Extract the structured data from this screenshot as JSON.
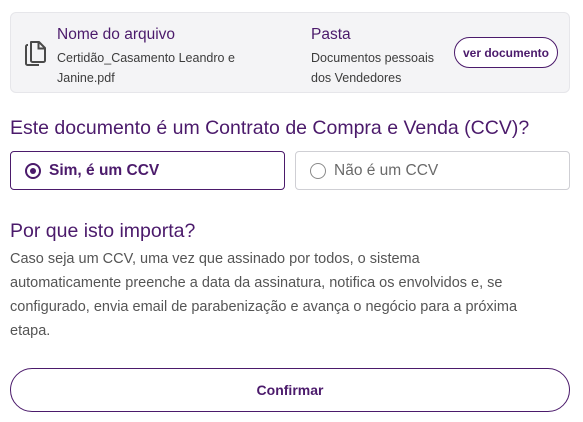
{
  "file_card": {
    "file_title": "Nome do arquivo",
    "file_name_line1": "Certidão_Casamento Leandro e",
    "file_name_line2": "Janine.pdf",
    "folder_title": "Pasta",
    "folder_name_line1": "Documentos pessoais",
    "folder_name_line2": "dos Vendedores",
    "view_button": "ver documento",
    "icon": "document-copy-icon"
  },
  "question": "Este documento é um Contrato de Compra e Venda (CCV)?",
  "options": {
    "yes_label": "Sim, é um CCV",
    "no_label": "Não é um CCV",
    "selected": "yes"
  },
  "why": {
    "title": "Por que isto importa?",
    "line1": "Caso seja um CCV, uma vez que assinado por todos, o sistema",
    "line2": "automaticamente preenche a data da assinatura, notifica os envolvidos e, se",
    "line3": "configurado, envia email de parabenização e avança o negócio para a próxima",
    "line4": "etapa."
  },
  "confirm_button": "Confirmar",
  "colors": {
    "accent": "#4b1a6b",
    "card_bg": "#f4f4f6",
    "text": "#555555"
  }
}
